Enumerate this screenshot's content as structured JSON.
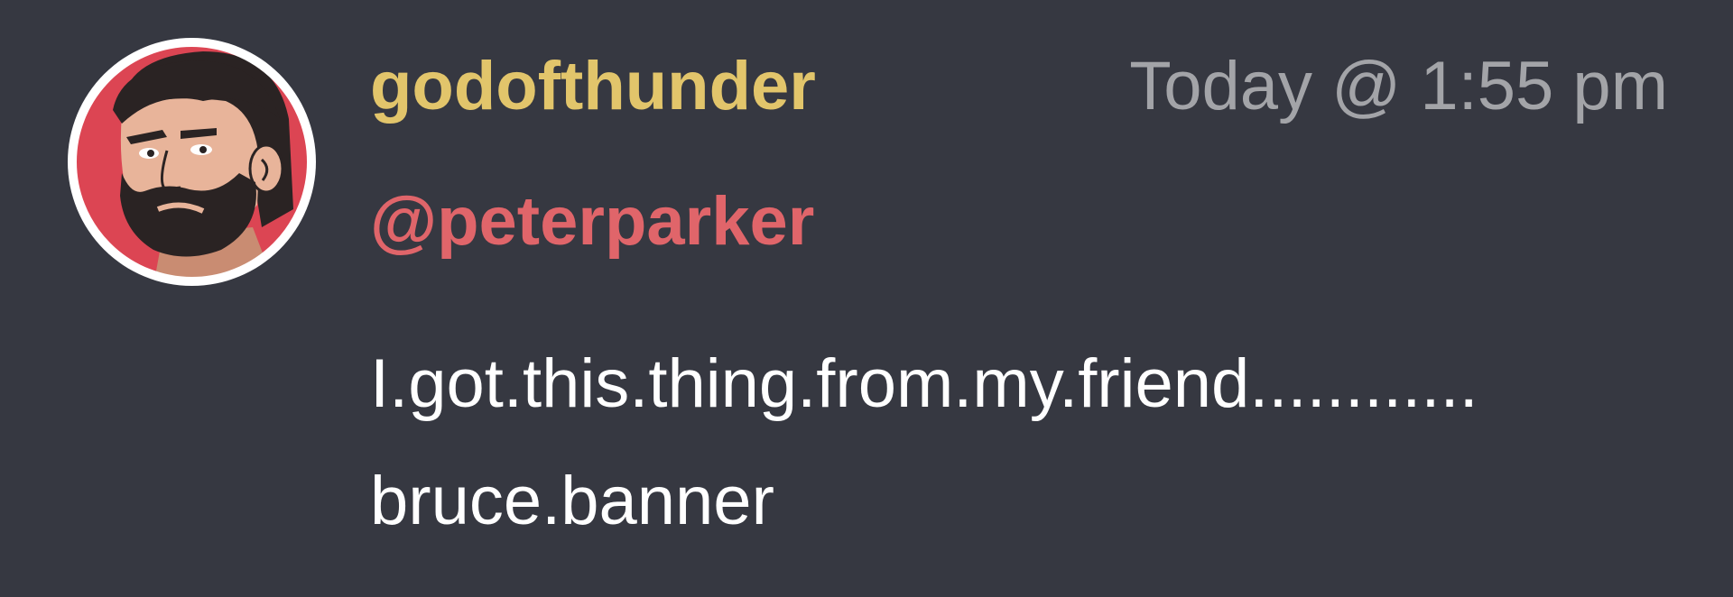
{
  "message": {
    "author": "godofthunder",
    "timestamp": "Today @ 1:55 pm",
    "mention": "@peterparker",
    "lines": [
      "I.got.this.thing.from.my.friend............",
      "bruce.banner"
    ],
    "avatar_icon": "bearded-man-avatar-icon"
  },
  "colors": {
    "background": "#363841",
    "author": "#e2c56b",
    "timestamp": "#a3a4a8",
    "mention": "#e0656a",
    "body_text": "#ffffff",
    "avatar_bg": "#dc4553",
    "avatar_border": "#ffffff"
  }
}
